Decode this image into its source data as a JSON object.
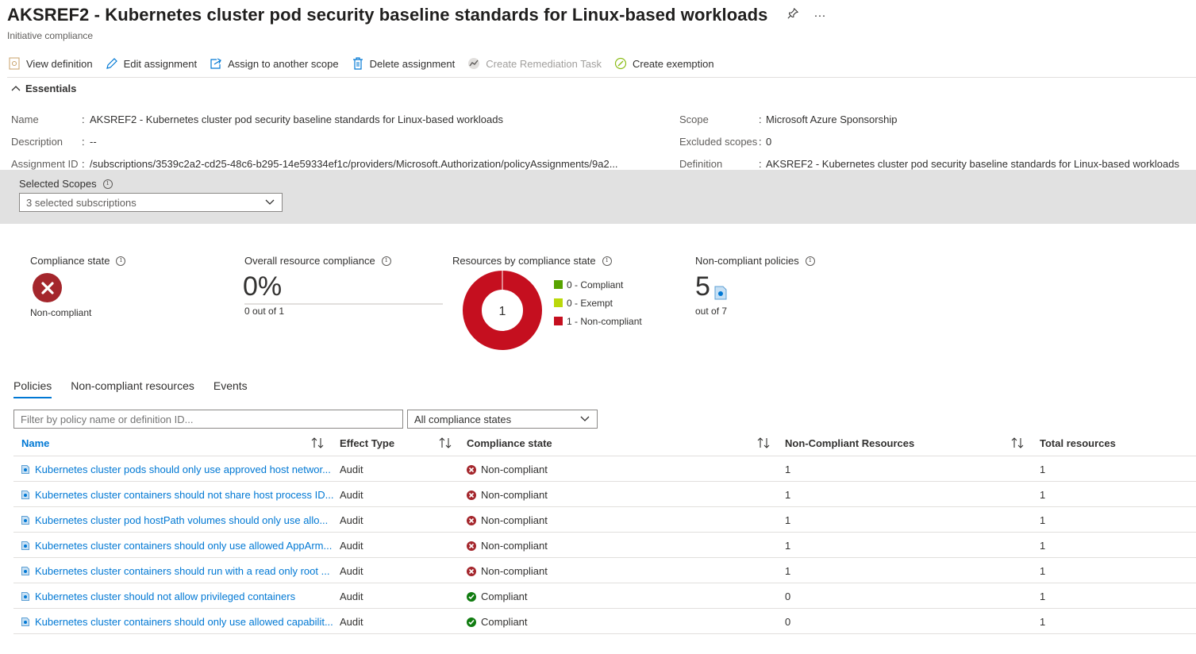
{
  "header": {
    "title": "AKSREF2 - Kubernetes cluster pod security baseline standards for Linux-based workloads",
    "subtitle": "Initiative compliance",
    "more_label": "···"
  },
  "toolbar": {
    "view_definition": "View definition",
    "edit_assignment": "Edit assignment",
    "assign_scope": "Assign to another scope",
    "delete_assignment": "Delete assignment",
    "create_remediation": "Create Remediation Task",
    "create_exemption": "Create exemption"
  },
  "essentials": {
    "header": "Essentials",
    "left": [
      {
        "key": "Name",
        "value": "AKSREF2 - Kubernetes cluster pod security baseline standards for Linux-based workloads"
      },
      {
        "key": "Description",
        "value": "--"
      },
      {
        "key": "Assignment ID",
        "value": "/subscriptions/3539c2a2-cd25-48c6-b295-14e59334ef1c/providers/Microsoft.Authorization/policyAssignments/9a2..."
      }
    ],
    "right": [
      {
        "key": "Scope",
        "value": "Microsoft Azure Sponsorship"
      },
      {
        "key": "Excluded scopes",
        "value": "0"
      },
      {
        "key": "Definition",
        "value": "AKSREF2 - Kubernetes cluster pod security baseline standards for Linux-based workloads"
      }
    ]
  },
  "scopes": {
    "label": "Selected Scopes",
    "value": "3 selected subscriptions"
  },
  "kpis": {
    "compliance_state_label": "Compliance state",
    "compliance_state_value": "Non-compliant",
    "overall_label": "Overall resource compliance",
    "overall_value": "0%",
    "overall_fraction": 0,
    "overall_sub": "0 out of 1",
    "donut_label": "Resources by compliance state",
    "donut_center": "1",
    "noncompliant_label": "Non-compliant policies",
    "noncompliant_value": "5",
    "noncompliant_sub": "out of 7"
  },
  "chart_data": {
    "type": "pie",
    "categories": [
      "Compliant",
      "Exempt",
      "Non-compliant"
    ],
    "values": [
      0,
      0,
      1
    ],
    "legend": [
      "0 - Compliant",
      "0 - Exempt",
      "1 - Non-compliant"
    ],
    "colors": [
      "#57a300",
      "#bad80a",
      "#c50f1f"
    ],
    "title": "Resources by compliance state"
  },
  "tabs": [
    "Policies",
    "Non-compliant resources",
    "Events"
  ],
  "filters": {
    "search_placeholder": "Filter by policy name or definition ID...",
    "state_value": "All compliance states"
  },
  "table": {
    "headers": {
      "name": "Name",
      "effect": "Effect Type",
      "state": "Compliance state",
      "noncompliant": "Non-Compliant Resources",
      "total": "Total resources"
    },
    "rows": [
      {
        "name": "Kubernetes cluster pods should only use approved host networ...",
        "effect": "Audit",
        "state": "Non-compliant",
        "noncompliant": "1",
        "total": "1"
      },
      {
        "name": "Kubernetes cluster containers should not share host process ID...",
        "effect": "Audit",
        "state": "Non-compliant",
        "noncompliant": "1",
        "total": "1"
      },
      {
        "name": "Kubernetes cluster pod hostPath volumes should only use allo...",
        "effect": "Audit",
        "state": "Non-compliant",
        "noncompliant": "1",
        "total": "1"
      },
      {
        "name": "Kubernetes cluster containers should only use allowed AppArm...",
        "effect": "Audit",
        "state": "Non-compliant",
        "noncompliant": "1",
        "total": "1"
      },
      {
        "name": "Kubernetes cluster containers should run with a read only root ...",
        "effect": "Audit",
        "state": "Non-compliant",
        "noncompliant": "1",
        "total": "1"
      },
      {
        "name": "Kubernetes cluster should not allow privileged containers",
        "effect": "Audit",
        "state": "Compliant",
        "noncompliant": "0",
        "total": "1"
      },
      {
        "name": "Kubernetes cluster containers should only use allowed capabilit...",
        "effect": "Audit",
        "state": "Compliant",
        "noncompliant": "0",
        "total": "1"
      }
    ]
  },
  "colors": {
    "accent": "#0078d4",
    "error": "#a4262c",
    "success": "#107c10"
  }
}
